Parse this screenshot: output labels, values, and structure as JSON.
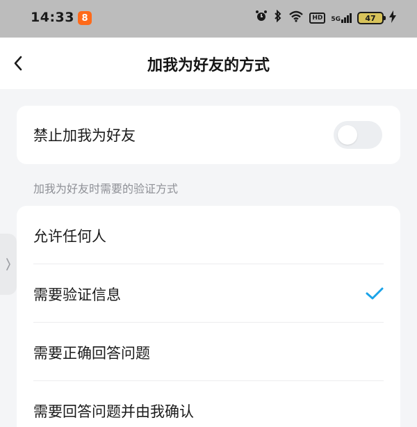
{
  "status_bar": {
    "time": "14:33",
    "app_badge": "8",
    "signal_label": "5G",
    "hd_label": "HD",
    "battery": "47"
  },
  "header": {
    "title": "加我为好友的方式"
  },
  "block_setting": {
    "label": "禁止加我为好友",
    "enabled": false
  },
  "verification": {
    "section_label": "加我为好友时需要的验证方式",
    "options": [
      {
        "label": "允许任何人",
        "selected": false
      },
      {
        "label": "需要验证信息",
        "selected": true
      },
      {
        "label": "需要正确回答问题",
        "selected": false
      },
      {
        "label": "需要回答问题并由我确认",
        "selected": false
      }
    ]
  },
  "colors": {
    "accent": "#1aa3e8",
    "status_bar": "#bcbcbc",
    "background": "#f4f5f7"
  },
  "icons": [
    "back-chevron-icon",
    "alarm-icon",
    "bluetooth-icon",
    "wifi-icon",
    "hd-icon",
    "signal-icon",
    "battery-icon",
    "charging-icon",
    "check-icon",
    "side-handle-chevron-icon"
  ]
}
